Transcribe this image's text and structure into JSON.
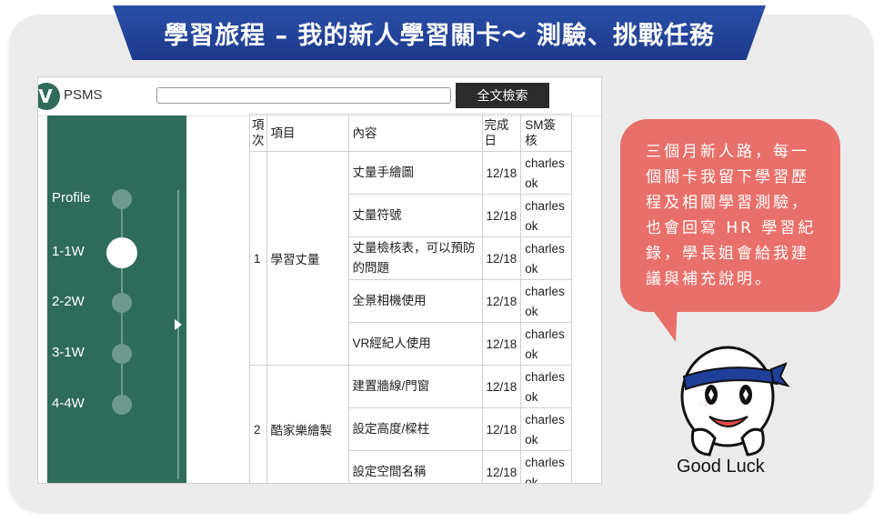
{
  "banner": {
    "title": "學習旅程 – 我的新人學習關卡～ 測驗、挑戰任務"
  },
  "app": {
    "logo_letter": "V",
    "logo_text": "PSMS",
    "search": {
      "value": "",
      "placeholder": ""
    },
    "search_button": "全文檢索"
  },
  "sidebar": {
    "steps": [
      {
        "label": "Profile"
      },
      {
        "label": "1-1W",
        "active": true
      },
      {
        "label": "2-2W"
      },
      {
        "label": "3-1W"
      },
      {
        "label": "4-4W"
      }
    ]
  },
  "table": {
    "headers": {
      "no": "項次",
      "item": "項目",
      "content": "內容",
      "date": "完成日",
      "sm": "SM簽核"
    },
    "groups": [
      {
        "no": "1",
        "item": "學習丈量",
        "rows": [
          {
            "content": "丈量手繪圖",
            "date": "12/18",
            "sm1": "charles",
            "sm2": "ok"
          },
          {
            "content": "丈量符號",
            "date": "12/18",
            "sm1": "charles",
            "sm2": "ok"
          },
          {
            "content": "丈量檢核表，可以預防的問題",
            "date": "12/18",
            "sm1": "charles",
            "sm2": "ok"
          },
          {
            "content": "全景相機使用",
            "date": "12/18",
            "sm1": "charles",
            "sm2": "ok"
          },
          {
            "content": "VR經紀人使用",
            "date": "12/18",
            "sm1": "charles",
            "sm2": "ok"
          }
        ]
      },
      {
        "no": "2",
        "item": "酷家樂繪製",
        "rows": [
          {
            "content": "建置牆線/門窗",
            "date": "12/18",
            "sm1": "charles",
            "sm2": "ok"
          },
          {
            "content": "設定高度/樑柱",
            "date": "12/18",
            "sm1": "charles",
            "sm2": "ok"
          },
          {
            "content": "設定空間名稱",
            "date": "12/18",
            "sm1": "charles",
            "sm2": "ok"
          }
        ]
      }
    ]
  },
  "callout": {
    "text": "三個月新人路，每一個關卡我留下學習歷程及相關學習測驗，也會回寫 HR 學習紀錄，學長姐會給我建議與補充說明。"
  },
  "mascot": {
    "caption": "Good Luck"
  },
  "colors": {
    "banner": "#1d3a8c",
    "sidebar": "#2e6b5a",
    "bubble": "#e9706a"
  }
}
